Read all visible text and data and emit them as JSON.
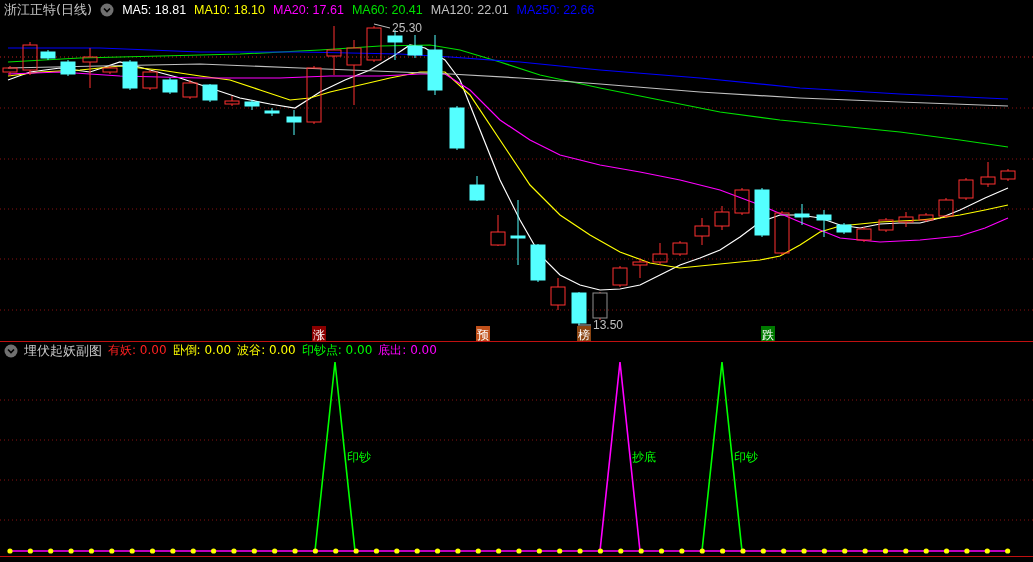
{
  "main_chart": {
    "title": "浙江正特(日线)",
    "indicators": [
      {
        "label": "MA5:",
        "value": "18.81",
        "color": "#ffffff"
      },
      {
        "label": "MA10:",
        "value": "18.10",
        "color": "#ffff00"
      },
      {
        "label": "MA20:",
        "value": "17.61",
        "color": "#ff00ff"
      },
      {
        "label": "MA60:",
        "value": "20.41",
        "color": "#00e000"
      },
      {
        "label": "MA120:",
        "value": "22.01",
        "color": "#c0c0c0"
      },
      {
        "label": "MA250:",
        "value": "22.66",
        "color": "#0000ff"
      }
    ],
    "price_marks": [
      "25.30",
      "13.50"
    ],
    "signal_badges": [
      {
        "text": "涨",
        "color": "#8b0000"
      },
      {
        "text": "预",
        "color": "#c0501a"
      },
      {
        "text": "榜",
        "color": "#8b4513"
      },
      {
        "text": "跌",
        "color": "#007a00"
      }
    ]
  },
  "sub_chart": {
    "title": "埋伏起妖副图",
    "indicators": [
      {
        "label": "有妖:",
        "value": "0.00",
        "color": "#ff2020"
      },
      {
        "label": "卧倒:",
        "value": "0.00",
        "color": "#ffff00"
      },
      {
        "label": "波谷:",
        "value": "0.00",
        "color": "#ffff00"
      },
      {
        "label": "印钞点:",
        "value": "0.00",
        "color": "#00ff00"
      },
      {
        "label": "底出:",
        "value": "0.00",
        "color": "#ff00ff"
      }
    ],
    "signals": [
      {
        "text": "印钞",
        "color": "#00ff00"
      },
      {
        "text": "抄底",
        "color": "#ff00ff"
      },
      {
        "text": "印钞",
        "color": "#00ff00"
      }
    ]
  }
}
